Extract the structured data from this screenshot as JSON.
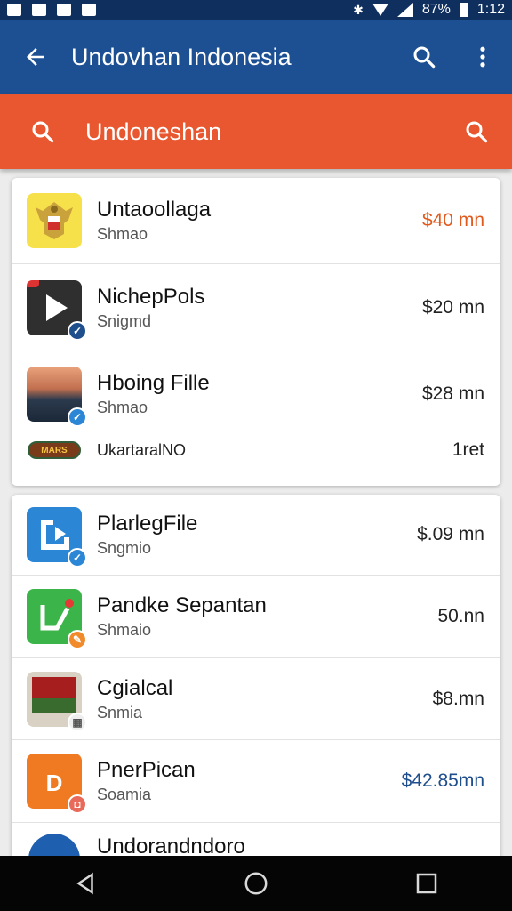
{
  "status_bar": {
    "battery": "87%",
    "time": "1:12"
  },
  "app_bar": {
    "back_icon": "arrow-left-icon",
    "title": "Undovhan Indonesia",
    "actions": [
      "search-icon",
      "more-vert-icon"
    ]
  },
  "search_bar": {
    "label": "Undoneshan",
    "leading_icon": "search-icon",
    "trailing_icon": "search-icon"
  },
  "card1": {
    "items": [
      {
        "name": "Untaoollaga",
        "sub": "Shmao",
        "price": "$40 mn",
        "price_color": "#e15a1d"
      },
      {
        "name": "NichepPols",
        "sub": "Snigmd",
        "price": "$20 mn",
        "price_color": "#222222"
      },
      {
        "name": "Hboing Fille",
        "sub": "Shmao",
        "price": "$28 mn",
        "price_color": "#222222"
      }
    ],
    "extra": {
      "logo": "MARS",
      "text": "UkartaralNO",
      "value": "1ret"
    }
  },
  "card2": {
    "items": [
      {
        "name": "PlarlegFile",
        "sub": "Sngmio",
        "price": "$.09 mn",
        "price_color": "#222222"
      },
      {
        "name": "Pandke Sepantan",
        "sub": "Shmaio",
        "price": "50.nn",
        "price_color": "#222222"
      },
      {
        "name": "Cgialcal",
        "sub": "Snmia",
        "price": "$8.mn",
        "price_color": "#222222"
      },
      {
        "name": "PnerPican",
        "sub": "Soamia",
        "price": "$42.85mn",
        "price_color": "#1f4e8c"
      },
      {
        "name": "Undorandndoro",
        "sub": "",
        "price": "",
        "price_color": "#222222"
      }
    ]
  },
  "nav_bar": [
    "back-icon",
    "home-icon",
    "recents-icon"
  ]
}
